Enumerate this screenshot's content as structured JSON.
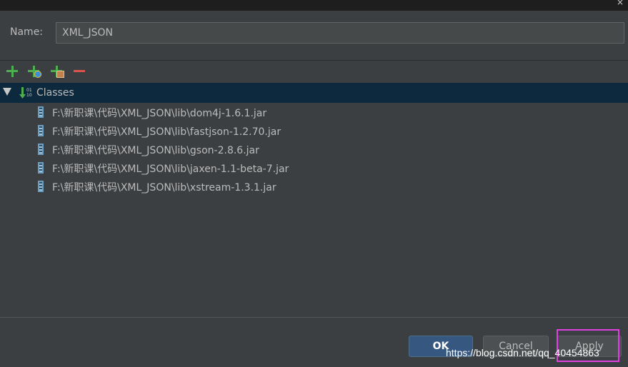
{
  "name_field": {
    "label": "Name:",
    "value": "XML_JSON"
  },
  "toolbar": {
    "items": [
      {
        "name": "add",
        "icon": "plus-icon"
      },
      {
        "name": "add-web",
        "icon": "plus-globe-icon"
      },
      {
        "name": "add-jar",
        "icon": "plus-jar-icon"
      },
      {
        "name": "remove",
        "icon": "minus-icon"
      }
    ]
  },
  "tree": {
    "root_label": "Classes",
    "items": [
      "F:\\新职课\\代码\\XML_JSON\\lib\\dom4j-1.6.1.jar",
      "F:\\新职课\\代码\\XML_JSON\\lib\\fastjson-1.2.70.jar",
      "F:\\新职课\\代码\\XML_JSON\\lib\\gson-2.8.6.jar",
      "F:\\新职课\\代码\\XML_JSON\\lib\\jaxen-1.1-beta-7.jar",
      "F:\\新职课\\代码\\XML_JSON\\lib\\xstream-1.3.1.jar"
    ]
  },
  "buttons": {
    "ok": "OK",
    "cancel": "Cancel",
    "apply": "Apply"
  },
  "watermark": "https://blog.csdn.net/qq_40454863",
  "colors": {
    "accent": "#365880",
    "selection": "#0d293e",
    "highlight": "#e040e0"
  }
}
